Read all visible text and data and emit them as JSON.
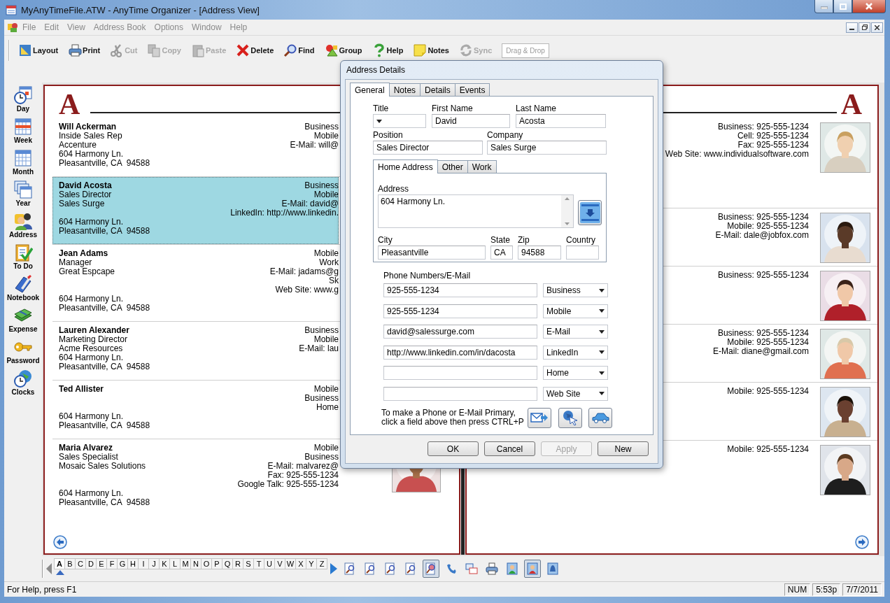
{
  "window": {
    "title": "MyAnyTimeFile.ATW - AnyTime Organizer - [Address View]"
  },
  "menu": [
    {
      "label": "File",
      "disabled": true
    },
    {
      "label": "Edit",
      "disabled": true
    },
    {
      "label": "View",
      "disabled": true
    },
    {
      "label": "Address Book",
      "disabled": true
    },
    {
      "label": "Options",
      "disabled": true
    },
    {
      "label": "Window",
      "disabled": true
    },
    {
      "label": "Help",
      "disabled": true
    }
  ],
  "toolbar": [
    {
      "label": "Layout",
      "disabled": false
    },
    {
      "label": "Print",
      "disabled": false
    },
    {
      "label": "Cut",
      "disabled": true
    },
    {
      "label": "Copy",
      "disabled": true
    },
    {
      "label": "Paste",
      "disabled": true
    },
    {
      "label": "Delete",
      "disabled": false
    },
    {
      "label": "Find",
      "disabled": false
    },
    {
      "label": "Group",
      "disabled": false
    },
    {
      "label": "Help",
      "disabled": false
    },
    {
      "label": "Notes",
      "disabled": false
    },
    {
      "label": "Sync",
      "disabled": true
    }
  ],
  "drop_target": "Drag & Drop",
  "sidebar": [
    {
      "label": "Day"
    },
    {
      "label": "Week"
    },
    {
      "label": "Month"
    },
    {
      "label": "Year"
    },
    {
      "label": "Address"
    },
    {
      "label": "To Do"
    },
    {
      "label": "Notebook"
    },
    {
      "label": "Expense"
    },
    {
      "label": "Password"
    },
    {
      "label": "Clocks"
    }
  ],
  "left_page": {
    "letter": "A",
    "entries": [
      {
        "name": "Will Ackerman",
        "lines": [
          "Inside Sales Rep",
          "Accenture"
        ],
        "contacts": [
          "Business",
          "Mobile",
          "E-Mail: will@"
        ],
        "address": [
          "604 Harmony Ln.",
          "Pleasantville, CA  94588"
        ],
        "selected": false
      },
      {
        "name": "David Acosta",
        "lines": [
          "Sales Director",
          "Sales Surge"
        ],
        "contacts": [
          "Business",
          "Mobile",
          "E-Mail: david@",
          "LinkedIn: http://www.linkedin."
        ],
        "address": [
          "604 Harmony Ln.",
          "Pleasantville, CA  94588"
        ],
        "selected": true
      },
      {
        "name": "Jean Adams",
        "lines": [
          "Manager",
          "Great Espcape"
        ],
        "contacts": [
          "Mobile",
          "Work",
          "E-Mail: jadams@g",
          "Sk",
          "Web Site: www.g"
        ],
        "address": [
          "604 Harmony Ln.",
          "Pleasantville, CA  94588"
        ],
        "selected": false
      },
      {
        "name": "Lauren Alexander",
        "lines": [
          "Marketing Director",
          "Acme Resources"
        ],
        "contacts": [
          "Business",
          "Mobile",
          "E-Mail: lau"
        ],
        "address": [
          "604 Harmony Ln.",
          "Pleasantville, CA  94588"
        ],
        "selected": false
      },
      {
        "name": "Ted Allister",
        "contacts": [
          "Mobile",
          "Business",
          "Home"
        ],
        "address": [
          "604 Harmony Ln.",
          "Pleasantville, CA  94588"
        ],
        "selected": false
      },
      {
        "name": "Maria Alvarez",
        "lines": [
          "Sales Specialist",
          "Mosaic Sales Solutions"
        ],
        "contacts": [
          "Mobile",
          "Business",
          "E-Mail: malvarez@",
          "Fax: 925-555-1234",
          "Google Talk: 925-555-1234"
        ],
        "address": [
          "604 Harmony Ln.",
          "Pleasantville, CA  94588"
        ],
        "selected": false,
        "photo": {
          "kind": "picture"
        }
      }
    ]
  },
  "right_page": {
    "letter": "A",
    "entries": [
      {
        "contacts": [
          "Business: 925-555-1234",
          "Cell: 925-555-1234",
          "Fax: 925-555-1234",
          "Web Site: www.individualsoftware.com"
        ],
        "photo": {
          "kind": "picture"
        }
      },
      {
        "contacts": [
          "Business: 925-555-1234",
          "Mobile: 925-555-1234",
          "E-Mail: dale@jobfox.com"
        ],
        "photo": {
          "kind": "picture"
        }
      },
      {
        "contacts": [
          "Business: 925-555-1234"
        ],
        "photo": {
          "kind": "picture"
        }
      },
      {
        "contacts": [
          "Business: 925-555-1234",
          "Mobile: 925-555-1234",
          "E-Mail: diane@gmail.com"
        ],
        "photo": {
          "kind": "picture"
        }
      },
      {
        "contacts": [
          "Mobile: 925-555-1234"
        ],
        "photo": {
          "kind": "picture"
        }
      },
      {
        "contacts": [
          "Mobile: 925-555-1234"
        ],
        "photo": {
          "kind": "picture"
        }
      }
    ]
  },
  "letters": [
    {
      "label": "A",
      "selected": true
    },
    {
      "label": "B",
      "selected": false
    },
    {
      "label": "C",
      "selected": false
    },
    {
      "label": "D",
      "selected": false
    },
    {
      "label": "E",
      "selected": false
    },
    {
      "label": "F",
      "selected": false
    },
    {
      "label": "G",
      "selected": false
    },
    {
      "label": "H",
      "selected": false
    },
    {
      "label": "I",
      "selected": false
    },
    {
      "label": "J",
      "selected": false
    },
    {
      "label": "K",
      "selected": false
    },
    {
      "label": "L",
      "selected": false
    },
    {
      "label": "M",
      "selected": false
    },
    {
      "label": "N",
      "selected": false
    },
    {
      "label": "O",
      "selected": false
    },
    {
      "label": "P",
      "selected": false
    },
    {
      "label": "Q",
      "selected": false
    },
    {
      "label": "R",
      "selected": false
    },
    {
      "label": "S",
      "selected": false
    },
    {
      "label": "T",
      "selected": false
    },
    {
      "label": "U",
      "selected": false
    },
    {
      "label": "V",
      "selected": false
    },
    {
      "label": "W",
      "selected": false
    },
    {
      "label": "X",
      "selected": false
    },
    {
      "label": "Y",
      "selected": false
    },
    {
      "label": "Z",
      "selected": false
    }
  ],
  "view_tools": [
    {
      "selected": false
    },
    {
      "selected": false
    },
    {
      "selected": false
    },
    {
      "selected": false
    },
    {
      "selected": true
    },
    {
      "selected": false
    },
    {
      "selected": false
    },
    {
      "selected": false
    },
    {
      "selected": false
    },
    {
      "selected": true
    },
    {
      "selected": false
    }
  ],
  "dialog": {
    "title": "Address Details",
    "tabs": [
      {
        "label": "General",
        "selected": true
      },
      {
        "label": "Notes",
        "selected": false
      },
      {
        "label": "Details",
        "selected": false
      },
      {
        "label": "Events",
        "selected": false
      }
    ],
    "title_field": {
      "label": "Title"
    },
    "first_name": {
      "label": "First Name",
      "value": "David"
    },
    "last_name": {
      "label": "Last Name",
      "value": "Acosta"
    },
    "position": {
      "label": "Position",
      "value": "Sales Director"
    },
    "company": {
      "label": "Company",
      "value": "Sales Surge"
    },
    "address_tabs": [
      {
        "label": "Home Address",
        "selected": true
      },
      {
        "label": "Other",
        "selected": false
      },
      {
        "label": "Work",
        "selected": false
      }
    ],
    "address": {
      "label": "Address",
      "value": "604 Harmony Ln."
    },
    "city": {
      "label": "City",
      "value": "Pleasantville"
    },
    "state": {
      "label": "State",
      "value": "CA"
    },
    "zip": {
      "label": "Zip",
      "value": "94588"
    },
    "country": {
      "label": "Country"
    },
    "phones_label": "Phone Numbers/E-Mail",
    "phones": [
      {
        "value": "925-555-1234",
        "type": "Business"
      },
      {
        "value": "925-555-1234",
        "type": "Mobile"
      },
      {
        "value": "david@salessurge.com",
        "type": "E-Mail"
      },
      {
        "value": "http://www.linkedin.com/in/dacosta",
        "type": "LinkedIn"
      },
      {
        "type": "Home"
      },
      {
        "type": "Web Site"
      }
    ],
    "hint": "To make a Phone or E-Mail Primary, click a field above then press CTRL+P",
    "buttons": [
      {
        "label": "OK",
        "disabled": false
      },
      {
        "label": "Cancel",
        "disabled": false
      },
      {
        "label": "Apply",
        "disabled": true
      },
      {
        "label": "New",
        "disabled": false
      }
    ]
  },
  "status_bar": {
    "help": "For Help, press F1",
    "num": "NUM",
    "time": "5:53p",
    "date": "7/7/2011"
  }
}
